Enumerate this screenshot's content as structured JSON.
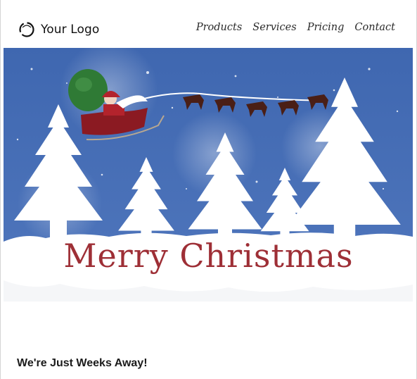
{
  "header": {
    "logo_text": "Your Logo",
    "nav": [
      {
        "label": "Products"
      },
      {
        "label": "Services"
      },
      {
        "label": "Pricing"
      },
      {
        "label": "Contact"
      }
    ]
  },
  "hero": {
    "greeting": "Merry Christmas",
    "colors": {
      "sky": "#4a70b5",
      "snow": "#ffffff",
      "greeting": "#9e2f36",
      "sleigh": "#8b1a22",
      "sack": "#2f7a35",
      "reindeer": "#4a1f16"
    }
  },
  "main": {
    "subheading": "We're Just Weeks Away!"
  }
}
